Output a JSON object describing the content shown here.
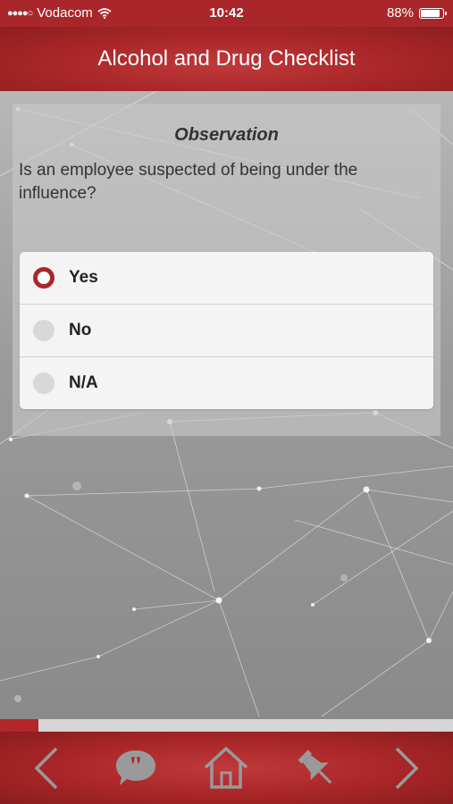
{
  "status_bar": {
    "signal_dots": "●●●●○",
    "carrier": "Vodacom",
    "time": "10:42",
    "battery_percent": "88%",
    "battery_level": 0.88
  },
  "header": {
    "title": "Alcohol and Drug Checklist"
  },
  "question_card": {
    "heading": "Observation",
    "question": "Is an employee suspected of being under the influence?",
    "options": [
      {
        "label": "Yes",
        "selected": true
      },
      {
        "label": "No",
        "selected": false
      },
      {
        "label": "N/A",
        "selected": false
      }
    ]
  },
  "progress": {
    "fraction": 0.085
  },
  "toolbar": {
    "icons": [
      "chevron-left-icon",
      "comment-icon",
      "home-icon",
      "pin-icon",
      "chevron-right-icon"
    ]
  },
  "colors": {
    "accent": "#a9272a",
    "icon_gray": "#9a9a9a"
  }
}
